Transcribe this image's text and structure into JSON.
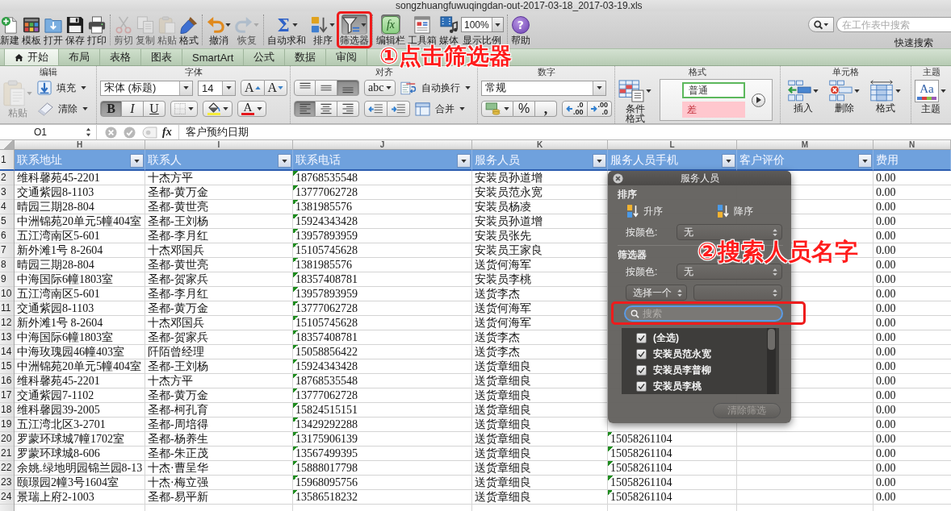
{
  "window": {
    "title": "songzhuangfuwuqingdan-out-2017-03-18_2017-03-19.xls"
  },
  "toolbar": {
    "groups": [
      {
        "items": [
          {
            "kind": "new",
            "label": "新建",
            "disabled": false,
            "pressed": false,
            "dropdown": false
          },
          {
            "kind": "templates",
            "label": "模板",
            "disabled": false,
            "pressed": false,
            "dropdown": false
          },
          {
            "kind": "open",
            "label": "打开",
            "disabled": false,
            "pressed": false,
            "dropdown": false
          },
          {
            "kind": "save",
            "label": "保存",
            "disabled": false,
            "pressed": false,
            "dropdown": false
          },
          {
            "kind": "print",
            "label": "打印",
            "disabled": false,
            "pressed": false,
            "dropdown": false
          }
        ]
      },
      {
        "items": [
          {
            "kind": "cut",
            "label": "剪切",
            "disabled": true,
            "pressed": false,
            "dropdown": false
          },
          {
            "kind": "copy",
            "label": "复制",
            "disabled": true,
            "pressed": false,
            "dropdown": false
          },
          {
            "kind": "paste",
            "label": "粘贴",
            "disabled": true,
            "pressed": false,
            "dropdown": false
          },
          {
            "kind": "painter",
            "label": "格式",
            "disabled": false,
            "pressed": false,
            "dropdown": false
          }
        ]
      },
      {
        "items": [
          {
            "kind": "undo",
            "label": "撤消",
            "disabled": false,
            "pressed": false,
            "dropdown": true
          },
          {
            "kind": "redo",
            "label": "恢复",
            "disabled": true,
            "pressed": false,
            "dropdown": true
          }
        ]
      },
      {
        "items": [
          {
            "kind": "sum",
            "label": "自动求和",
            "glyph": "Σ",
            "disabled": false,
            "pressed": false,
            "dropdown": true
          },
          {
            "kind": "sort",
            "label": "排序",
            "disabled": false,
            "pressed": false,
            "dropdown": true
          },
          {
            "kind": "filter",
            "label": "筛选器",
            "disabled": false,
            "pressed": true,
            "dropdown": true
          }
        ]
      },
      {
        "items": [
          {
            "kind": "formula",
            "label": "编辑栏",
            "glyph": "fx",
            "disabled": false,
            "pressed": true,
            "dropdown": false
          },
          {
            "kind": "toolbox",
            "label": "工具箱",
            "disabled": false,
            "pressed": false,
            "dropdown": false
          },
          {
            "kind": "media",
            "label": "媒体",
            "disabled": false,
            "pressed": false,
            "dropdown": false
          },
          {
            "kind": "zoom",
            "label": "显示比例",
            "value": "100%",
            "disabled": false,
            "pressed": false,
            "dropdown": true
          }
        ]
      },
      {
        "items": [
          {
            "kind": "help",
            "label": "帮助",
            "glyph": "?",
            "disabled": false,
            "pressed": false,
            "dropdown": false
          }
        ]
      }
    ],
    "search": {
      "placeholder": "在工作表中搜索",
      "label": "快速搜索"
    }
  },
  "ribbon_tabs": [
    {
      "kind": "home",
      "label": "开始",
      "selected": true
    },
    {
      "kind": "plain",
      "label": "布局",
      "selected": false
    },
    {
      "kind": "plain",
      "label": "表格",
      "selected": false
    },
    {
      "kind": "plain",
      "label": "图表",
      "selected": false
    },
    {
      "kind": "plain",
      "label": "SmartArt",
      "selected": false
    },
    {
      "kind": "plain",
      "label": "公式",
      "selected": false
    },
    {
      "kind": "plain",
      "label": "数据",
      "selected": false
    },
    {
      "kind": "plain",
      "label": "审阅",
      "selected": false
    }
  ],
  "ribbon": {
    "groups": [
      {
        "kind": "edit",
        "title": "编辑",
        "paste": {
          "label": "粘贴",
          "disabled": true
        },
        "fill": "填充",
        "clear": "清除"
      },
      {
        "kind": "font",
        "title": "字体",
        "font_name": "宋体 (标题)",
        "font_size": "14",
        "size_buttons": [
          {
            "kind": "grow",
            "label": "A"
          },
          {
            "kind": "shrink",
            "label": "A"
          }
        ],
        "styles": [
          {
            "kind": "bold",
            "label": "B",
            "pressed": true
          },
          {
            "kind": "italic",
            "label": "I",
            "pressed": false
          },
          {
            "kind": "underline",
            "label": "U",
            "pressed": false
          }
        ],
        "fill_color": {
          "color": "#f5ec3a"
        },
        "font_color": {
          "label": "A",
          "color": "#e4161c"
        }
      },
      {
        "kind": "align",
        "title": "对齐",
        "vertical": [
          {
            "kind": "top",
            "selected": false
          },
          {
            "kind": "middle",
            "selected": false
          },
          {
            "kind": "bottom",
            "selected": true
          }
        ],
        "orientation": "abc",
        "wrap": "自动换行",
        "horizontal": [
          {
            "kind": "left",
            "selected": true
          },
          {
            "kind": "center",
            "selected": false
          },
          {
            "kind": "right",
            "selected": false
          }
        ],
        "merge": "合并"
      },
      {
        "kind": "number",
        "title": "数字",
        "format": "常规",
        "percent": "%",
        "comma": ",",
        "decimals": [
          {
            "kind": "increase",
            "top": ".0",
            "bottom": ".00"
          },
          {
            "kind": "decrease",
            "top": ".00",
            "bottom": ".0"
          }
        ]
      },
      {
        "kind": "format",
        "title": "格式",
        "conditional": "条件格式",
        "styles": [
          {
            "kind": "normal",
            "label": "普通"
          },
          {
            "kind": "bad",
            "label": "差"
          }
        ]
      },
      {
        "kind": "cells",
        "title": "单元格",
        "buttons": [
          {
            "kind": "insert",
            "label": "插入"
          },
          {
            "kind": "delete",
            "label": "删除"
          },
          {
            "kind": "format",
            "label": "格式"
          }
        ]
      },
      {
        "kind": "theme",
        "title": "主题",
        "preview": "Aa",
        "label": "主题"
      }
    ]
  },
  "formula_bar": {
    "cell": "O1",
    "fx": "fx",
    "content": "客户预约日期"
  },
  "sheet": {
    "header_row_number": "1",
    "columns": [
      {
        "letter": "H",
        "header": "联系地址",
        "filter": true,
        "number_as_text_marker": false
      },
      {
        "letter": "I",
        "header": "联系人",
        "filter": true,
        "number_as_text_marker": false
      },
      {
        "letter": "J",
        "header": "联系电话",
        "filter": true,
        "number_as_text_marker": true
      },
      {
        "letter": "K",
        "header": "服务人员",
        "filter": true,
        "number_as_text_marker": false
      },
      {
        "letter": "L",
        "header": "服务人员手机",
        "filter": true,
        "number_as_text_marker": true
      },
      {
        "letter": "M",
        "header": "客户评价",
        "filter": true
      },
      {
        "letter": "N",
        "header": "费用",
        "filter": false,
        "number_as_text_marker": false
      }
    ],
    "rows": [
      {
        "number": "2",
        "cells": [
          "维科馨苑45-2201",
          "十杰方平",
          "18768535548",
          "安装员孙道增",
          null,
          null,
          "0.00"
        ]
      },
      {
        "number": "3",
        "cells": [
          "交通紫园8-1103",
          "圣都-黄万金",
          "13777062728",
          "安装员范永宽",
          null,
          null,
          "0.00"
        ]
      },
      {
        "number": "4",
        "cells": [
          "晴园三期28-804",
          "圣都-黄世亮",
          "1381985576",
          "安装员杨凌",
          null,
          null,
          "0.00"
        ]
      },
      {
        "number": "5",
        "cells": [
          "中洲锦苑20单元5幢404室",
          "圣都-王刘杨",
          "15924343428",
          "安装员孙道增",
          null,
          null,
          "0.00"
        ]
      },
      {
        "number": "6",
        "cells": [
          "五江湾南区5-601",
          "圣都-李月红",
          "13957893959",
          "安装员张先",
          null,
          null,
          "0.00"
        ]
      },
      {
        "number": "7",
        "cells": [
          "新外滩1号 8-2604",
          "十杰邓国兵",
          "15105745628",
          "安装员王家良",
          null,
          null,
          "0.00"
        ]
      },
      {
        "number": "8",
        "cells": [
          "晴园三期28-804",
          "圣都-黄世亮",
          "1381985576",
          "送货何海军",
          null,
          null,
          "0.00"
        ]
      },
      {
        "number": "9",
        "cells": [
          "中海国际6幢1803室",
          "圣都-贺家兵",
          "18357408781",
          "安装员李桃",
          null,
          null,
          "0.00"
        ]
      },
      {
        "number": "10",
        "cells": [
          "五江湾南区5-601",
          "圣都-李月红",
          "13957893959",
          "送货李杰",
          null,
          null,
          "0.00"
        ]
      },
      {
        "number": "11",
        "cells": [
          "交通紫园8-1103",
          "圣都-黄万金",
          "13777062728",
          "送货何海军",
          null,
          null,
          "0.00"
        ]
      },
      {
        "number": "12",
        "cells": [
          "新外滩1号 8-2604",
          "十杰邓国兵",
          "15105745628",
          "送货何海军",
          null,
          null,
          "0.00"
        ]
      },
      {
        "number": "13",
        "cells": [
          "中海国际6幢1803室",
          "圣都-贺家兵",
          "18357408781",
          "送货李杰",
          null,
          null,
          "0.00"
        ]
      },
      {
        "number": "14",
        "cells": [
          "中海玫瑰园46幢403室",
          "阡陌曾经理",
          "15058856422",
          "送货李杰",
          null,
          null,
          "0.00"
        ]
      },
      {
        "number": "15",
        "cells": [
          "中洲锦苑20单元5幢404室",
          "圣都-王刘杨",
          "15924343428",
          "送货章细良",
          null,
          null,
          "0.00"
        ]
      },
      {
        "number": "16",
        "cells": [
          "维科馨苑45-2201",
          "十杰方平",
          "18768535548",
          "送货章细良",
          null,
          null,
          "0.00"
        ]
      },
      {
        "number": "17",
        "cells": [
          "交通紫园7-1102",
          "圣都-黄万金",
          "13777062728",
          "送货章细良",
          null,
          null,
          "0.00"
        ]
      },
      {
        "number": "18",
        "cells": [
          "维科馨园39-2005",
          "圣都-柯孔育",
          "15824515151",
          "送货章细良",
          null,
          null,
          "0.00"
        ]
      },
      {
        "number": "19",
        "cells": [
          "五江湾北区3-2701",
          "圣都-周培得",
          "13429292288",
          "送货章细良",
          null,
          null,
          "0.00"
        ]
      },
      {
        "number": "20",
        "cells": [
          "罗蒙环球城7幢1702室",
          "圣都-杨养生",
          "13175906139",
          "送货章细良",
          "15058261104",
          null,
          "0.00"
        ]
      },
      {
        "number": "21",
        "cells": [
          "罗蒙环球城8-606",
          "圣都-朱正茂",
          "13567499395",
          "送货章细良",
          "15058261104",
          null,
          "0.00"
        ]
      },
      {
        "number": "22",
        "cells": [
          "余姚.绿地明园锦兰园8-13",
          "十杰·曹呈华",
          "15888017798",
          "送货章细良",
          "15058261104",
          null,
          "0.00"
        ]
      },
      {
        "number": "23",
        "cells": [
          "颐璟园2幢3号1604室",
          "十杰·梅立强",
          "15968095756",
          "送货章细良",
          "15058261104",
          null,
          "0.00"
        ]
      },
      {
        "number": "24",
        "cells": [
          "景瑞上府2-1003",
          "圣都-易平新",
          "13586518232",
          "送货章细良",
          "15058261104",
          null,
          "0.00"
        ]
      }
    ]
  },
  "filter_popup": {
    "title": "服务人员",
    "sort_title": "排序",
    "sort_buttons": [
      {
        "kind": "ascending",
        "label": "升序"
      },
      {
        "kind": "descending",
        "label": "降序"
      }
    ],
    "sort_color": {
      "label": "按颜色:",
      "value": "无"
    },
    "filter_title": "筛选器",
    "filter_color": {
      "label": "按颜色:",
      "value": "无"
    },
    "condition": {
      "value": "选择一个"
    },
    "search": {
      "placeholder": "搜索"
    },
    "items": [
      {
        "label": "(全选)",
        "checked": true
      },
      {
        "label": "安装员范永宽",
        "checked": true
      },
      {
        "label": "安装员李普柳",
        "checked": true
      },
      {
        "label": "安装员李桃",
        "checked": true
      }
    ],
    "clear_button": {
      "label": "清除筛选",
      "disabled": true
    }
  },
  "annotations": [
    {
      "text": "①点击筛选器"
    },
    {
      "text": "②搜索人员名字"
    }
  ]
}
